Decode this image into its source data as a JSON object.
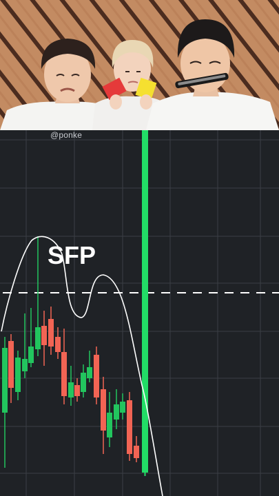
{
  "overlay": {
    "handle": "@ponke",
    "pattern_label": "SFP"
  },
  "photo": {
    "description_icons": [
      "red-card-icon",
      "yellow-card-icon",
      "harmonica-icon"
    ]
  },
  "colors": {
    "chart_background": "#1f2226",
    "bull_candle": "#22c55e",
    "bear_candle": "#f26454",
    "highlight_candle": "#22dd66",
    "sketch_line": "#ffffff",
    "level_line": "#ffffff",
    "wood_stripe_light": "#b9805a",
    "wood_stripe_dark": "#4d2d1f"
  }
}
